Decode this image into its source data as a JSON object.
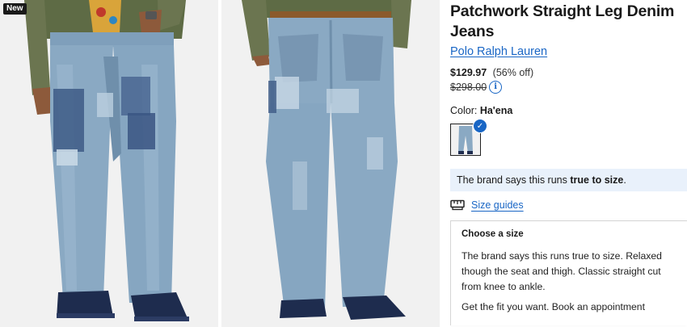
{
  "badge": "New",
  "product": {
    "title": "Patchwork Straight Leg Denim Jeans",
    "brand": "Polo Ralph Lauren",
    "price_now": "$129.97",
    "discount": "(56% off)",
    "price_was": "$298.00",
    "color_label": "Color:",
    "color_value": "Ha'ena"
  },
  "fit_note": {
    "prefix": "The brand says this runs ",
    "emphasis": "true to size",
    "suffix": "."
  },
  "size_guides_label": "Size guides",
  "size_panel": {
    "title": "Choose a size",
    "text": "The brand says this runs true to size. Relaxed though the seat and thigh. Classic straight cut from knee to ankle.",
    "text2": "Get the fit you want. Book an appointment"
  },
  "colors": {
    "link": "#1966c5",
    "fit_bg": "#e9f1fb",
    "denim": "#8aa9c3",
    "shoe": "#1e2c4e"
  },
  "icons": {
    "info": "info-icon",
    "check": "check-icon",
    "size_guide": "ruler-tag-icon"
  }
}
